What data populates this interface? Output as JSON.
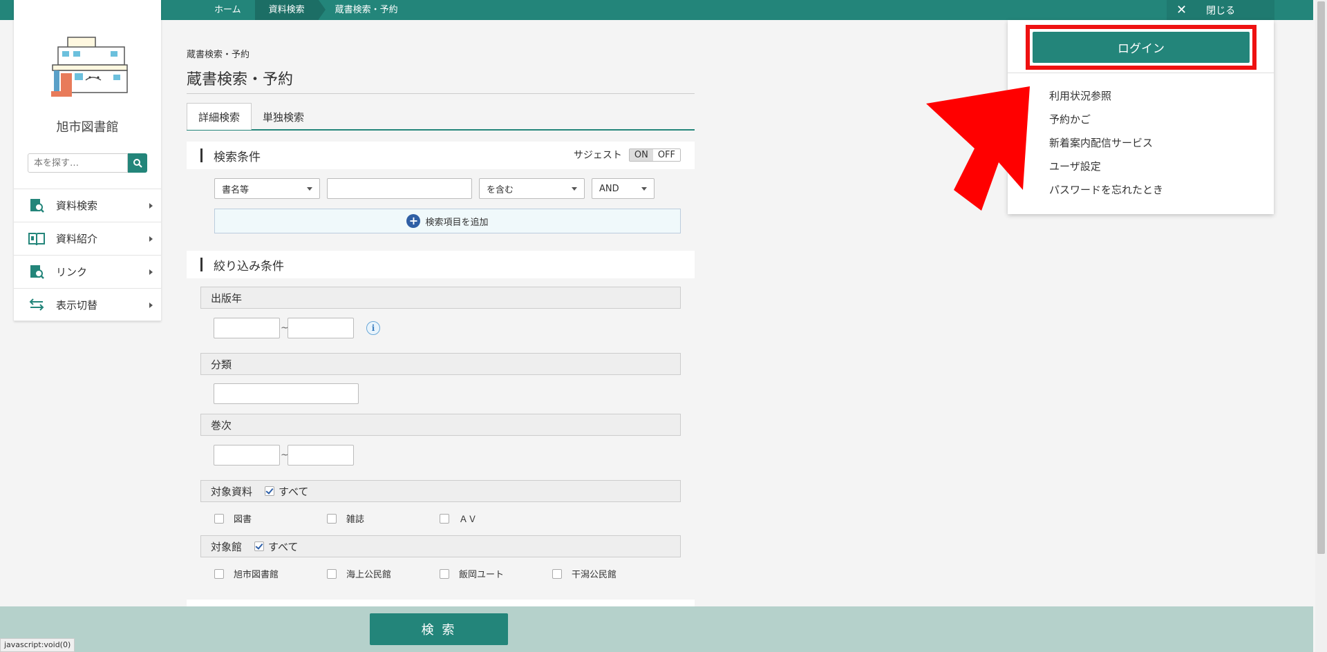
{
  "breadcrumbs": [
    "ホーム",
    "資料検索",
    "蔵書検索・予約"
  ],
  "close_label": "閉じる",
  "sidebar": {
    "library_name": "旭市図書館",
    "search_placeholder": "本を探す…",
    "items": [
      {
        "label": "資料検索",
        "icon": "book-search-icon"
      },
      {
        "label": "資料紹介",
        "icon": "open-book-icon"
      },
      {
        "label": "リンク",
        "icon": "book-search-icon"
      },
      {
        "label": "表示切替",
        "icon": "swap-arrows-icon"
      }
    ]
  },
  "main": {
    "page_crumb": "蔵書検索・予約",
    "page_title": "蔵書検索・予約",
    "tabs": [
      {
        "label": "詳細検索",
        "active": true
      },
      {
        "label": "単独検索",
        "active": false
      }
    ],
    "search_conditions": {
      "title": "検索条件",
      "suggest_label": "サジェスト",
      "toggle_on": "ON",
      "toggle_off": "OFF",
      "field_select": "書名等",
      "keyword_value": "",
      "match_select": "を含む",
      "logic_select": "AND",
      "add_item_label": "検索項目を追加"
    },
    "filters": {
      "title": "絞り込み条件",
      "publish_year": "出版年",
      "tilde": "~",
      "classification": "分類",
      "volume": "巻次",
      "target_material": "対象資料",
      "target_library": "対象館",
      "all_label": "すべて",
      "materials": [
        "図書",
        "雑誌",
        "ＡＶ"
      ],
      "libraries": [
        "旭市図書館",
        "海上公民館",
        "飯岡ユート",
        "干潟公民館"
      ]
    },
    "search_button": "検 索"
  },
  "user_panel": {
    "login_label": "ログイン",
    "links": [
      "利用状況参照",
      "予約かご",
      "新着案内配信サービス",
      "ユーザ設定",
      "パスワードを忘れたとき"
    ]
  },
  "status_text": "javascript:void(0)",
  "colors": {
    "brand": "#23857a",
    "highlight": "#ee1111"
  }
}
